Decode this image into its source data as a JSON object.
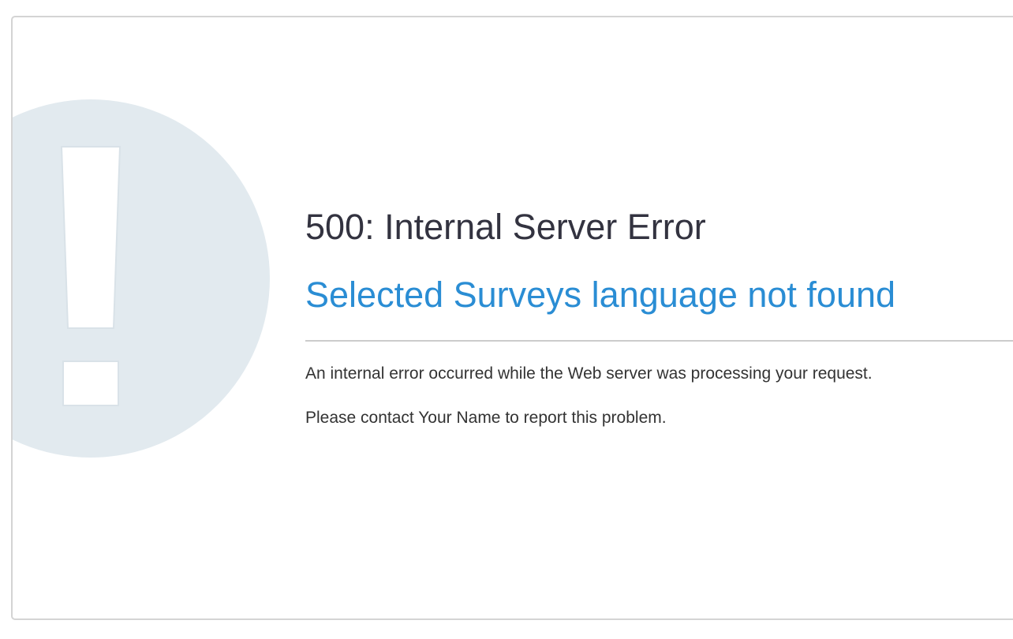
{
  "error": {
    "title": "500: Internal Server Error",
    "subtitle": "Selected Surveys language not found",
    "description": "An internal error occurred while the Web server was processing your request.",
    "contact": "Please contact Your Name to report this problem."
  },
  "icons": {
    "background_graphic": "exclamation-icon"
  },
  "colors": {
    "title": "#333340",
    "subtitle": "#2a8dd4",
    "graphic_circle": "#e2eaef",
    "divider": "#cccccc",
    "panel_border": "#d4d4d4"
  }
}
